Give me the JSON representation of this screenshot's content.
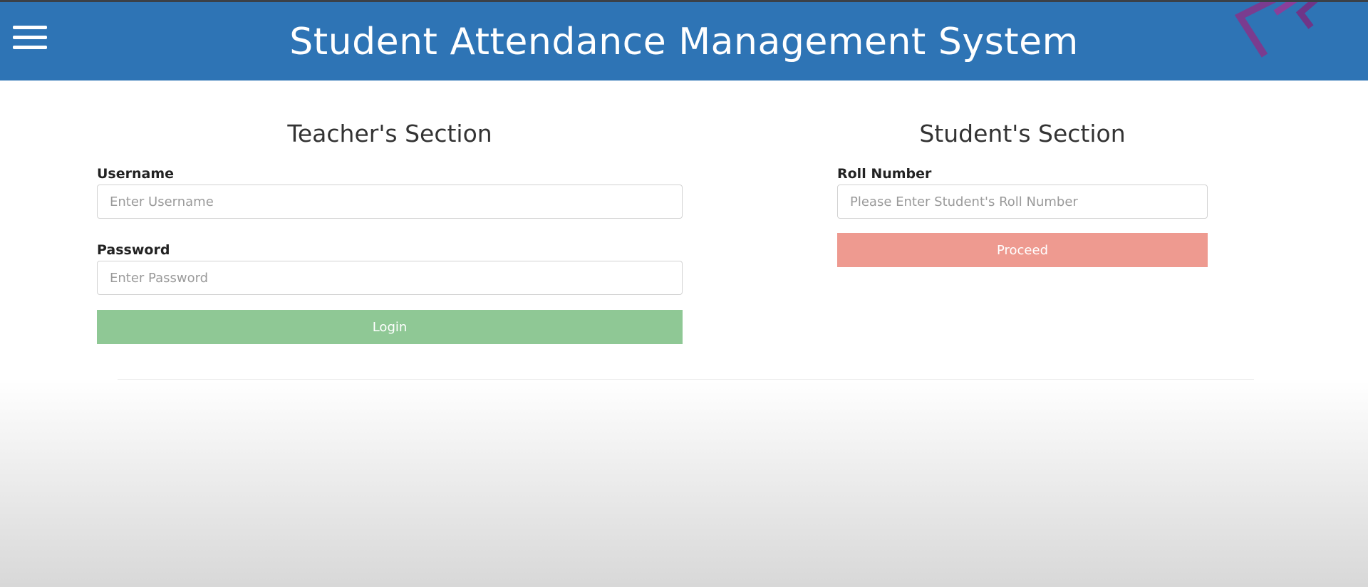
{
  "header": {
    "title": "Student Attendance Management System",
    "bar_color": "#2e74b5",
    "menu_icon": "hamburger-menu-icon",
    "logo_icon": "chevron-logo-icon"
  },
  "teacher_section": {
    "title": "Teacher's Section",
    "username_label": "Username",
    "username_placeholder": "Enter Username",
    "username_value": "",
    "password_label": "Password",
    "password_placeholder": "Enter Password",
    "password_value": "",
    "login_label": "Login",
    "login_color": "#8fc895"
  },
  "student_section": {
    "title": "Student's Section",
    "roll_label": "Roll Number",
    "roll_placeholder": "Please Enter Student's Roll Number",
    "roll_value": "",
    "proceed_label": "Proceed",
    "proceed_color": "#ee9a90"
  }
}
